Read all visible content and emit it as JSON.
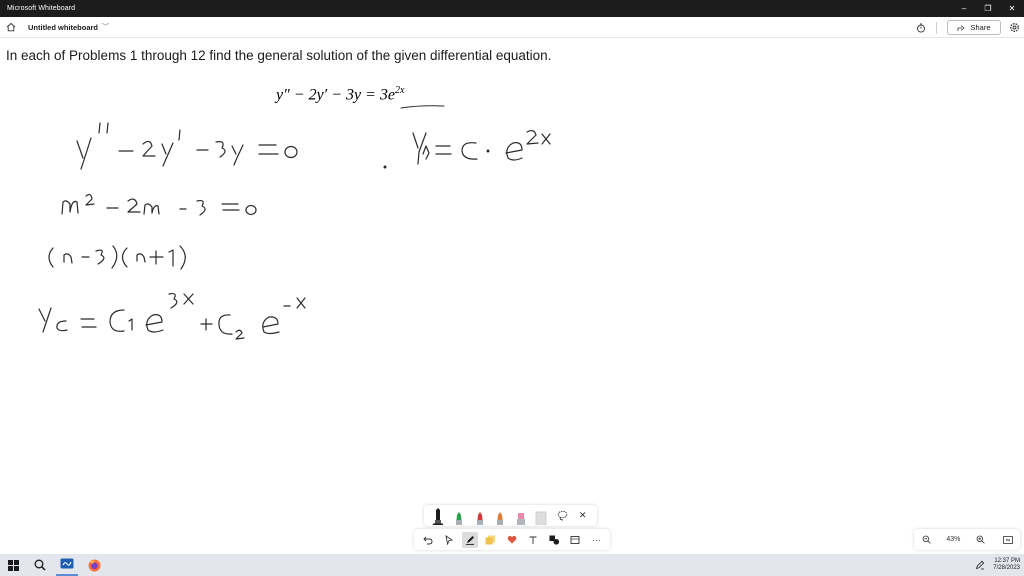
{
  "window": {
    "app_title": "Microsoft Whiteboard",
    "minimize_glyph": "–",
    "restore_glyph": "❐",
    "close_glyph": "✕"
  },
  "header": {
    "board_title": "Untitled whiteboard",
    "share_label": "Share"
  },
  "canvas": {
    "problem_text": "In each of Problems 1 through 12 find the general solution of the given differential equation.",
    "equation": "y″ − 2y′ − 3y = 3e",
    "equation_exponent": "2x",
    "handwriting": {
      "line1": "y'' - 2y' - 3y = 0",
      "line1_right": "Yp = C · e^2x",
      "line2": "m^2 - 2m - 3 = 0",
      "line3": "(m-3)(m+1)",
      "line4": "Yc = C1 e^3x + C2 e^-x"
    },
    "ink_color": "#2b2b2b"
  },
  "bottom_toolbar": {
    "more_glyph": "···",
    "close_glyph": "✕"
  },
  "zoom": {
    "level": "43%"
  },
  "taskbar": {
    "time": "12:37 PM",
    "date": "7/28/2023"
  },
  "colors": {
    "titlebar": "#1c1c1c",
    "taskbar": "#e3e7ed",
    "pen_black": "#1b1b1b",
    "pen_green": "#2e9e4f",
    "pen_red": "#d63a3a",
    "pen_orange": "#e07b39",
    "highlighter_pink": "#f08aa8",
    "favorite_heart": "#e2543e",
    "sticky_note": "#f2c14e"
  }
}
